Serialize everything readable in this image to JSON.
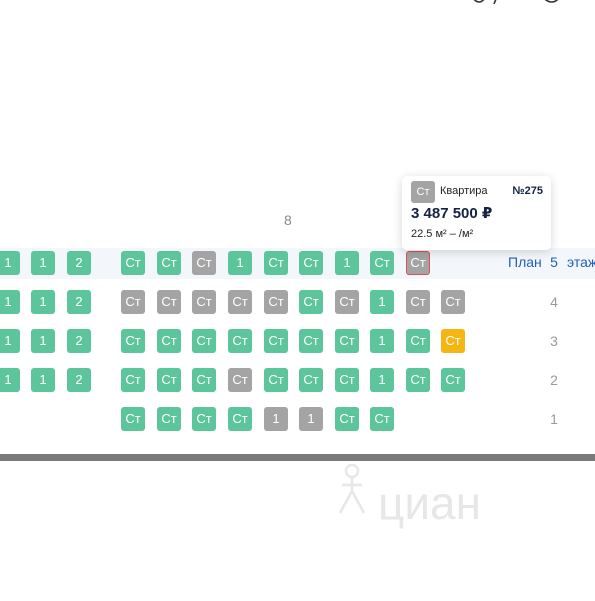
{
  "section_label": "8",
  "plan_link": "План",
  "floor_word": "этаж",
  "floors": [
    "5",
    "4",
    "3",
    "2",
    "1"
  ],
  "rows": [
    [
      "1",
      "1",
      "2",
      "Ст",
      "Ст",
      "Ст",
      "1",
      "Ст",
      "Ст",
      "1",
      "Ст",
      "Ст"
    ],
    [
      "1",
      "1",
      "2",
      "Ст",
      "Ст",
      "Ст",
      "Ст",
      "Ст",
      "Ст",
      "Ст",
      "1",
      "Ст",
      "Ст"
    ],
    [
      "1",
      "1",
      "2",
      "Ст",
      "Ст",
      "Ст",
      "Ст",
      "Ст",
      "Ст",
      "Ст",
      "1",
      "Ст",
      "Ст"
    ],
    [
      "1",
      "1",
      "2",
      "Ст",
      "Ст",
      "Ст",
      "Ст",
      "Ст",
      "Ст",
      "Ст",
      "1",
      "Ст",
      "Ст"
    ],
    [
      "Ст",
      "Ст",
      "Ст",
      "Ст",
      "1",
      "1",
      "Ст",
      "Ст"
    ]
  ],
  "colors": {
    "available": "#5cc59b",
    "sold": "#a4a4a4",
    "reserved": "#f5b512",
    "selected_border": "#e05050",
    "link": "#1f5fbf"
  },
  "tooltip": {
    "badge": "Ст",
    "type": "Квартира",
    "number": "№275",
    "price": "3 487 500 ₽",
    "area": "22.5 м² – /м²"
  },
  "watermark": {
    "text": "циан",
    "icon": "cian-logo-icon"
  }
}
